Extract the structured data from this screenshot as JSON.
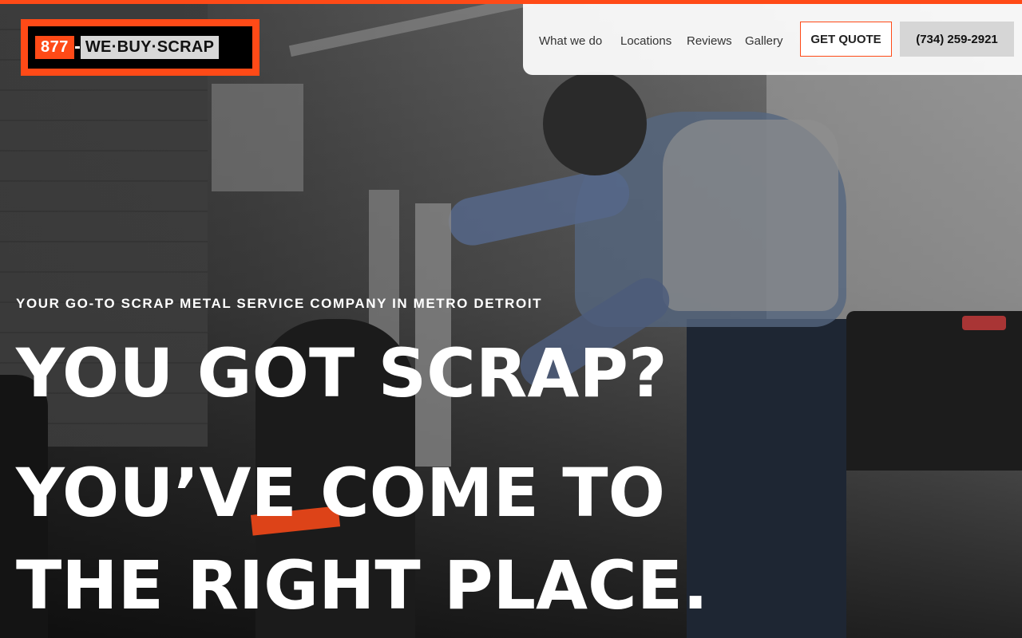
{
  "logo": {
    "number": "877",
    "text": "WE·BUY·SCRAP"
  },
  "nav": {
    "links": [
      "What we do",
      "Locations",
      "Reviews",
      "Gallery"
    ],
    "quote_label": "GET QUOTE",
    "phone_label": "(734) 259-2921"
  },
  "hero": {
    "eyebrow": "YOUR GO-TO SCRAP METAL SERVICE COMPANY IN METRO DETROIT",
    "headline_1": "YOU GOT SCRAP?",
    "headline_2": "YOU’VE COME TO",
    "headline_3": "THE RIGHT PLACE."
  },
  "colors": {
    "accent": "#ff4a17",
    "nav_bg": "#ffffff",
    "phone_bg": "#d6d6d6",
    "text_light": "#ffffff"
  },
  "icons": {
    "background": "workshop-photo"
  }
}
